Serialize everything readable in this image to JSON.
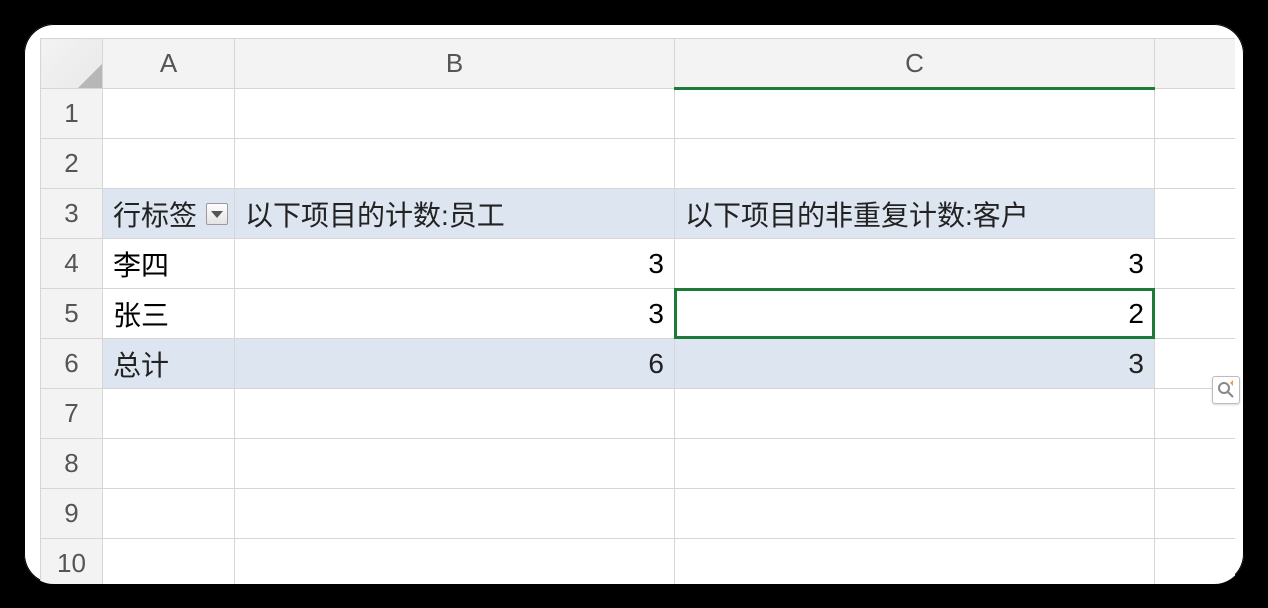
{
  "columnHeaders": {
    "A": "A",
    "B": "B",
    "C": "C"
  },
  "rowHeaders": [
    "1",
    "2",
    "3",
    "4",
    "5",
    "6",
    "7",
    "8",
    "9",
    "10"
  ],
  "activeRow": 5,
  "pivot": {
    "rowLabelHeader": "行标签",
    "colHeaders": {
      "countEmployee": "以下项目的计数:员工",
      "distinctCountCustomer": "以下项目的非重复计数:客户"
    },
    "rows": [
      {
        "label": "李四",
        "countEmployee": 3,
        "distinctCountCustomer": 3
      },
      {
        "label": "张三",
        "countEmployee": 3,
        "distinctCountCustomer": 2
      }
    ],
    "total": {
      "label": "总计",
      "countEmployee": 6,
      "distinctCountCustomer": 3
    }
  },
  "selectedCellValue": 2,
  "icons": {
    "filter": "filter-dropdown-icon",
    "quickAnalysis": "quick-analysis-icon"
  }
}
